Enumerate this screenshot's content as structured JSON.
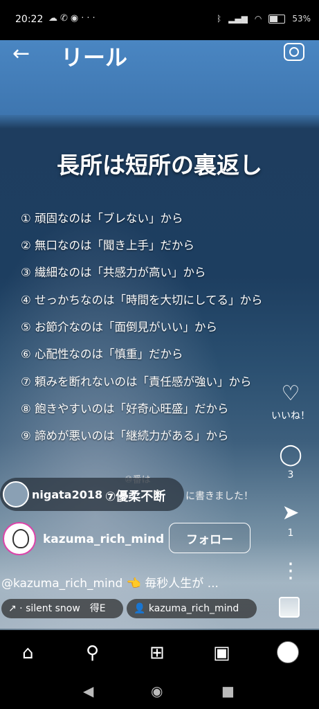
{
  "status_bar": {
    "time": "20:22",
    "battery": "53%"
  },
  "header": {
    "title": "リール"
  },
  "reel": {
    "headline": "長所は短所の裏返し",
    "items": [
      "① 頑固なのは「ブレない」から",
      "② 無口なのは「聞き上手」だから",
      "③ 繊細なのは「共感力が高い」から",
      "④ せっかちなのは「時間を大切にしてる」から",
      "⑤ お節介なのは「面倒見がいい」から",
      "⑥ 心配性なのは「慎重」だから",
      "⑦ 頼みを断れないのは「責任感が強い」から",
      "⑧ 飽きやすいのは「好奇心旺盛」だから",
      "⑨ 諦めが悪いのは「継続力がある」から"
    ],
    "tenth_caption": "⑩番は",
    "tenth_caption_tail": "に書きました！"
  },
  "tag": {
    "username": "nigata2018",
    "text": "⑦優柔不断"
  },
  "author": {
    "username": "kazuma_rich_mind",
    "follow_label": "フォロー"
  },
  "description": "@kazuma_rich_mind 👈 毎秒人生が ...",
  "chips": {
    "audio": "↗ · silent snow　得E",
    "user": "kazuma_rich_mind"
  },
  "actions": {
    "like_label": "いいね！",
    "comments": "3",
    "shares": "1"
  }
}
